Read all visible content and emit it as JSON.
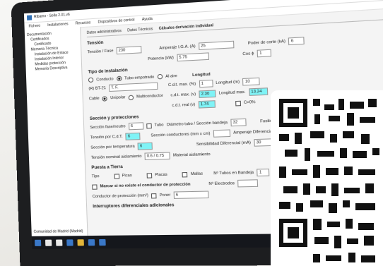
{
  "window": {
    "title": "Ribamo - Sella 2.01.v6"
  },
  "menu": [
    "Fichero",
    "Instalaciones",
    "Recursos",
    "Dispositivos de control",
    "Ayuda"
  ],
  "tree": {
    "items": [
      "Documentación",
      "Certificados",
      "Certificado",
      "Memoria Técnica",
      "Instalación de Enlace",
      "Instalación Interior",
      "Medidas protección",
      "Memoria Descriptiva"
    ],
    "footer": "Comunidad de Madrid (Madrid)"
  },
  "tabs": [
    "Datos administrativos",
    "Datos Técnicos",
    "Cálculos derivación individual"
  ],
  "tension": {
    "section": "Tensión",
    "label": "Tensión / Fase",
    "value": "230",
    "power_label": "Amperaje I.G.A. (A)",
    "power_value": "25",
    "potencia_label": "Potencia (kW)",
    "potencia_value": "5.75",
    "poder_corte_label": "Poder de corte (kA)",
    "poder_corte_value": "6",
    "cos_label": "Cos ϕ",
    "cos_value": "1"
  },
  "instalacion": {
    "section": "Tipo de instalación",
    "opt1": "Conducto",
    "opt2": "Tubo empotrado",
    "opt3": "Al aire",
    "method_label": "(R) BT-21",
    "method_value": "T. F.",
    "cable_label": "Cable",
    "cable_opt1": "Unipolar",
    "cable_opt2": "Multiconductor"
  },
  "longitud": {
    "section": "Longitud",
    "cdt_label": "C.d.t. max. (%)",
    "cdt_value": "1",
    "longitud_label": "Longitud (m)",
    "longitud_value": "10",
    "cdt2_label": "c.d.t. max. (v)",
    "cdt2_value": "2.30",
    "longmax_label": "Longitud max.",
    "longmax_value": "13.24",
    "cdt3_label": "c.d.t. real (v)",
    "cdt3_value": "1.74",
    "cdt_check": "C>0%"
  },
  "seccion": {
    "section": "Sección y protecciones",
    "s_fase_label": "Sección fase/neutro",
    "s_fase_value": "6",
    "tubo_label": "Tubo",
    "diam_label": "Diámetro tubo / Sección bandeja",
    "diam_value": "32",
    "fusibles_label": "Fusibles",
    "fusibles_value": "63",
    "imax_label": "Tensión por C.d.T.",
    "imax_value": "6",
    "s_cond_label": "Sección conductores (mm x cm)",
    "amp_label": "Amperaje Diferencial (A)",
    "amp_value": "40",
    "s_prot_label": "Sección por temperatura",
    "s_prot_value": "6",
    "sens_label": "Sensibilidad Diferencial (mA)",
    "sens_value": "30",
    "tension_nom_label": "Tensión nominal aislamiento",
    "tension_nom_value": "0.6 / 0.75",
    "mat_label": "Material aislamiento"
  },
  "tierra": {
    "section": "Puesta a Tierra",
    "tipo_label": "Tipo",
    "opt1": "Picas",
    "opt2": "Placas",
    "opt3": "Mallas",
    "nf_label": "Nº Tubos en Bandeja",
    "nf_value": "1",
    "nf2_label": "Nº Electrodos"
  },
  "bottom": {
    "check_label": "Marcar si no existe el conductor de protección",
    "cond_label": "Conductor de protección (mm²)",
    "poner_label": "Poner",
    "poner_value": "6",
    "extra": "Interruptores diferenciales adicionales"
  },
  "qr": {
    "present": true
  }
}
